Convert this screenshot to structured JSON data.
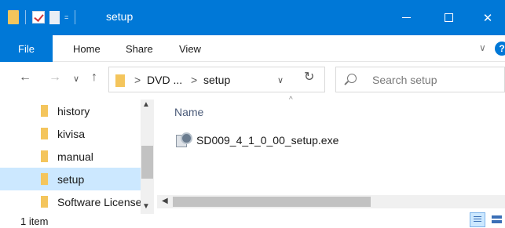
{
  "window": {
    "title": "setup",
    "qat_arrow": "=",
    "controls": {
      "minimize": "",
      "maximize": "",
      "close": "✕"
    }
  },
  "ribbon": {
    "tabs": [
      "File",
      "Home",
      "Share",
      "View"
    ],
    "help": "?",
    "expand": "∨"
  },
  "address_bar": {
    "back": "←",
    "forward": "→",
    "recent": "∨",
    "up": "↑",
    "breadcrumb": [
      "DVD ...",
      "setup"
    ],
    "separator": ">",
    "dropdown": "∨",
    "refresh": "↻"
  },
  "search": {
    "placeholder": "Search setup"
  },
  "nav_pane": {
    "items": [
      {
        "label": "history",
        "selected": false
      },
      {
        "label": "kivisa",
        "selected": false
      },
      {
        "label": "manual",
        "selected": false
      },
      {
        "label": "setup",
        "selected": true
      },
      {
        "label": "Software License",
        "selected": false
      }
    ]
  },
  "content": {
    "column_header": "Name",
    "sort_indicator": "^",
    "files": [
      {
        "name": "SD009_4_1_0_00_setup.exe",
        "icon": "installer-icon"
      }
    ]
  },
  "status_bar": {
    "item_count": "1 item"
  },
  "colors": {
    "accent": "#0078d7",
    "selection": "#cce8ff",
    "folder": "#f4c55c"
  }
}
